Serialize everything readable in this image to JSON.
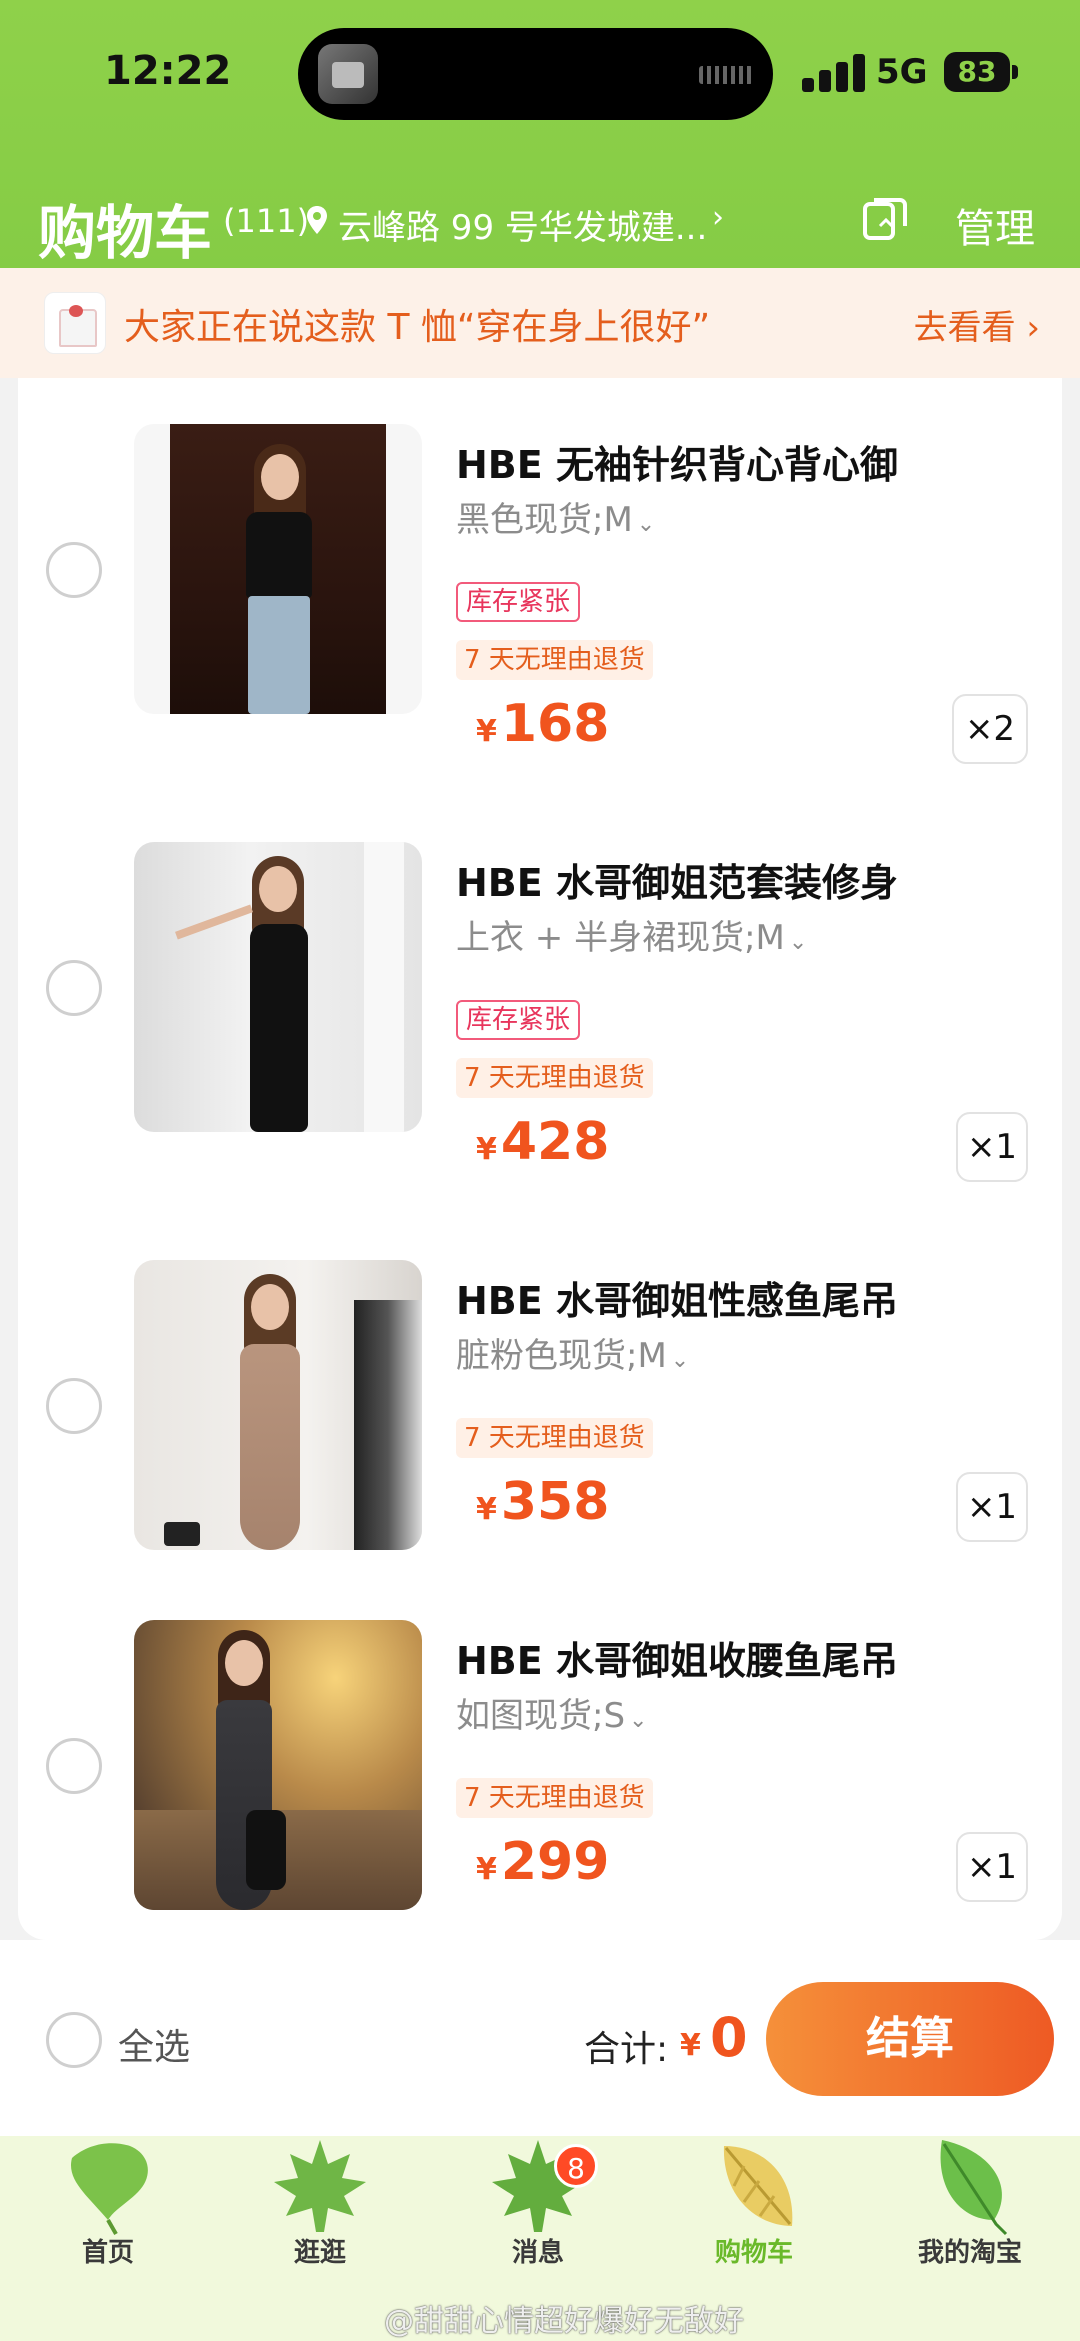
{
  "status_bar": {
    "time": "12:22",
    "network": "5G",
    "battery": "83"
  },
  "header": {
    "title": "购物车",
    "count": "(111)",
    "address": "云峰路 99 号华发城建...",
    "address_arrow": "›",
    "manage_label": "管理"
  },
  "promo": {
    "text": "大家正在说这款 T 恤“穿在身上很好”",
    "link": "去看看 ›"
  },
  "items": [
    {
      "name": "HBE 无袖针织背心背心御",
      "variant": "黑色现货;M",
      "stock_tag": "库存紧张",
      "return_tag": "7 天无理由退货",
      "currency": "¥",
      "price": "168",
      "qty": "×2"
    },
    {
      "name": "HBE 水哥御姐范套装修身",
      "variant": "上衣 + 半身裙现货;M",
      "stock_tag": "库存紧张",
      "return_tag": "7 天无理由退货",
      "currency": "¥",
      "price": "428",
      "qty": "×1"
    },
    {
      "name": "HBE 水哥御姐性感鱼尾吊",
      "variant": "脏粉色现货;M",
      "return_tag": "7 天无理由退货",
      "currency": "¥",
      "price": "358",
      "qty": "×1"
    },
    {
      "name": "HBE 水哥御姐收腰鱼尾吊",
      "variant": "如图现货;S",
      "return_tag": "7 天无理由退货",
      "currency": "¥",
      "price": "299",
      "qty": "×1"
    }
  ],
  "checkout": {
    "select_all": "全选",
    "total_label": "合计:",
    "currency": "¥",
    "total": "0",
    "pay_label": "结算"
  },
  "tabs": [
    {
      "label": "首页",
      "icon": "ginkgo-leaf-icon"
    },
    {
      "label": "逛逛",
      "icon": "maple-leaf-icon"
    },
    {
      "label": "消息",
      "icon": "maple-leaf-icon",
      "badge": "8"
    },
    {
      "label": "购物车",
      "icon": "golden-leaf-icon",
      "active": true
    },
    {
      "label": "我的淘宝",
      "icon": "green-leaf-icon"
    }
  ],
  "watermark": "@甜甜心情超好爆好无敌好",
  "colors": {
    "header_green": "#8fd14a",
    "accent_orange": "#f0541e",
    "active_tab": "#6ab92a"
  }
}
